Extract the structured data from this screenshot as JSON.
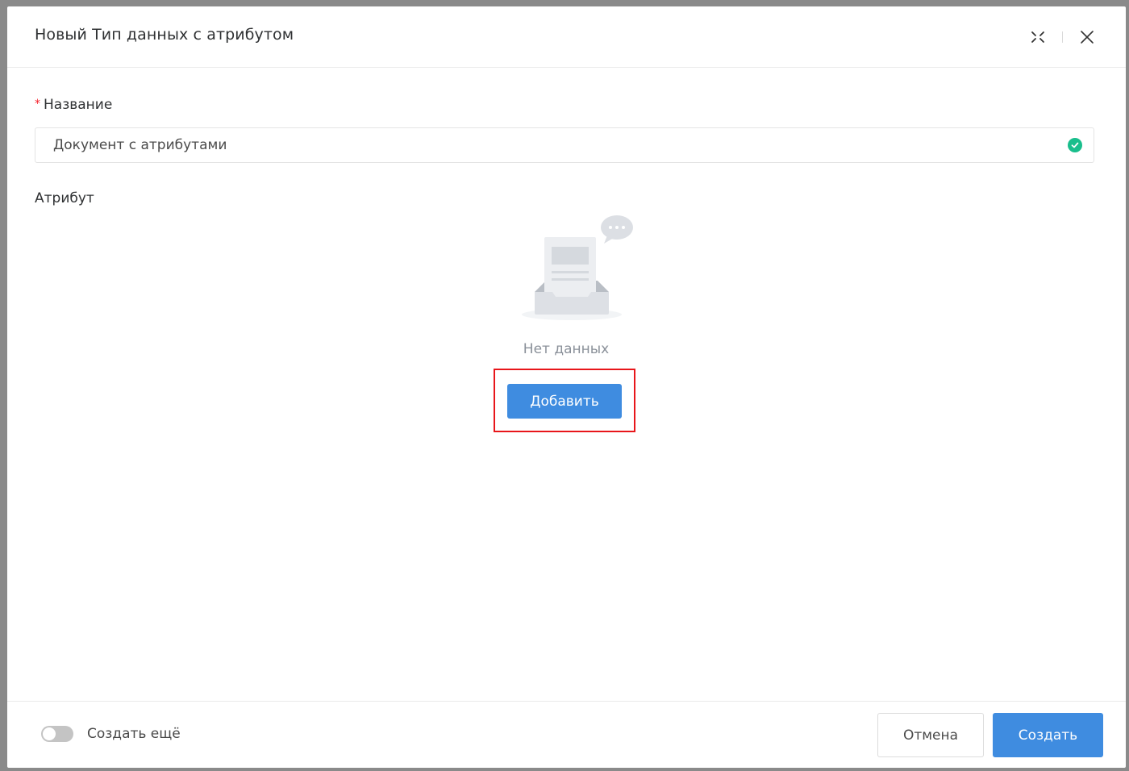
{
  "modal": {
    "title": "Новый Тип данных с атрибутом"
  },
  "header_icons": {
    "collapse": "collapse-arrows-icon",
    "close": "close-icon"
  },
  "form": {
    "name_label": "Название",
    "required_mark": "*",
    "name_value": "Документ с атрибутами",
    "attribute_label": "Атрибут"
  },
  "empty_state": {
    "text": "Нет данных",
    "add_button": "Добавить"
  },
  "footer": {
    "toggle_label": "Создать ещё",
    "toggle_on": false,
    "cancel_button": "Отмена",
    "create_button": "Создать"
  },
  "colors": {
    "primary": "#3f8ce0",
    "success": "#19be8c",
    "required": "#f5222d",
    "highlight": "#e8161a"
  }
}
